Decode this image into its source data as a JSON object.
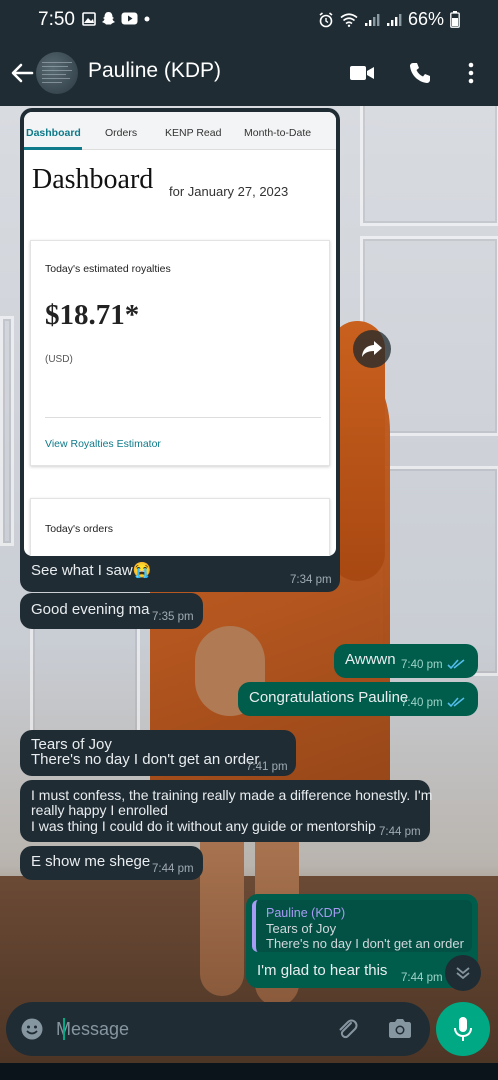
{
  "status_bar": {
    "time": "7:50",
    "battery": "66%",
    "left_icons": [
      "gallery-icon",
      "snapchat-icon",
      "youtube-icon",
      "dot-icon"
    ],
    "right_icons": [
      "alarm-icon",
      "wifi-icon",
      "signal-icon",
      "signal-icon",
      "battery-icon"
    ]
  },
  "header": {
    "contact_name": "Pauline (KDP)",
    "actions": [
      "video-call-icon",
      "voice-call-icon",
      "more-options-icon"
    ]
  },
  "image_message": {
    "screenshot": {
      "tabs": [
        "Dashboard",
        "Orders",
        "KENP Read",
        "Month-to-Date"
      ],
      "active_tab": "Dashboard",
      "title": "Dashboard",
      "subtitle": "for January 27, 2023",
      "royalties_label": "Today's estimated royalties",
      "royalties_value": "$18.71*",
      "currency": "(USD)",
      "estimator_link": "View Royalties Estimator",
      "orders_label": "Today's orders"
    },
    "caption": "See what I saw😭",
    "time": "7:34 pm"
  },
  "messages": [
    {
      "direction": "in",
      "lines": [
        "Good evening ma"
      ],
      "time": "7:35 pm"
    },
    {
      "direction": "out",
      "lines": [
        "Awwwn"
      ],
      "time": "7:40 pm",
      "status": "read"
    },
    {
      "direction": "out",
      "lines": [
        "Congratulations Pauline"
      ],
      "time": "7:40 pm",
      "status": "read"
    },
    {
      "direction": "in",
      "lines": [
        "Tears of Joy",
        "There's no day I don't get an order"
      ],
      "time": "7:41 pm"
    },
    {
      "direction": "in",
      "lines": [
        "I must confess, the training really made a difference honestly. I'm",
        "really happy I enrolled",
        "I was thing I could do it without any guide or mentorship"
      ],
      "time": "7:44 pm"
    },
    {
      "direction": "in",
      "lines": [
        "E show me shege"
      ],
      "time": "7:44 pm"
    }
  ],
  "reply_message": {
    "quoted_author": "Pauline (KDP)",
    "quoted_lines": [
      "Tears of Joy",
      "There's no day I don't get an order"
    ],
    "text": "I'm glad to hear this",
    "time": "7:44 pm"
  },
  "composer": {
    "placeholder": "Message",
    "icons": [
      "emoji-icon",
      "attach-icon",
      "camera-icon",
      "mic-icon"
    ]
  },
  "colors": {
    "header_bg": "#1f2c34",
    "incoming_bubble": "#1f2c34",
    "outgoing_bubble": "#005c4b",
    "accent": "#00a884",
    "read_tick": "#53bdeb"
  }
}
